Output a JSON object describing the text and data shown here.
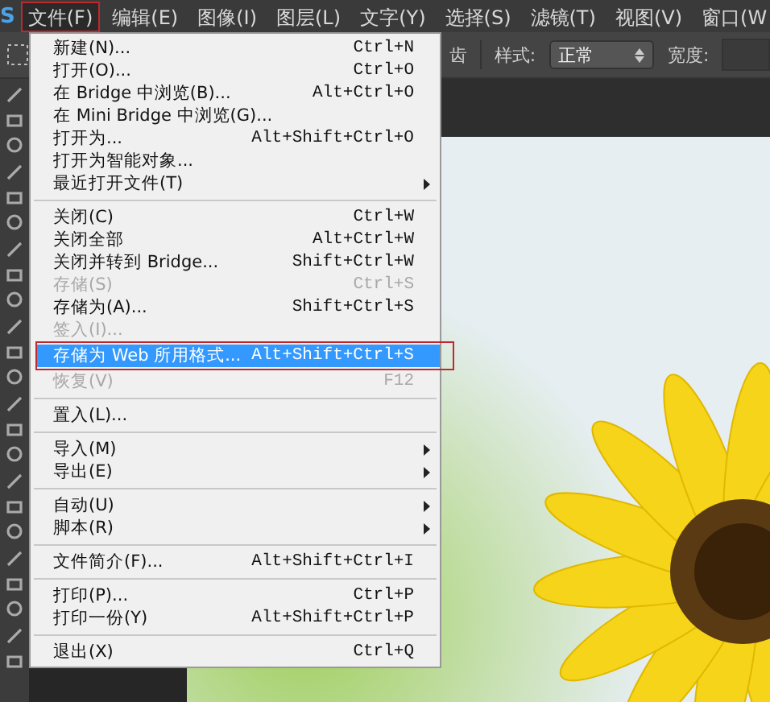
{
  "app_logo": "S",
  "menubar": [
    {
      "label": "文件(F)",
      "selected": true,
      "outlined": true
    },
    {
      "label": "编辑(E)",
      "selected": false,
      "outlined": false
    },
    {
      "label": "图像(I)",
      "selected": false,
      "outlined": false
    },
    {
      "label": "图层(L)",
      "selected": false,
      "outlined": false
    },
    {
      "label": "文字(Y)",
      "selected": false,
      "outlined": false
    },
    {
      "label": "选择(S)",
      "selected": false,
      "outlined": false
    },
    {
      "label": "滤镜(T)",
      "selected": false,
      "outlined": false
    },
    {
      "label": "视图(V)",
      "selected": false,
      "outlined": false
    },
    {
      "label": "窗口(W",
      "selected": false,
      "outlined": false
    }
  ],
  "options_bar": {
    "antialias_label": "齿",
    "style_label": "样式:",
    "style_value": "正常",
    "width_label": "宽度:"
  },
  "file_menu": [
    {
      "kind": "item",
      "label": "新建(N)...",
      "shortcut": "Ctrl+N",
      "disabled": false,
      "selected": false,
      "submenu": false,
      "outlined": false
    },
    {
      "kind": "item",
      "label": "打开(O)...",
      "shortcut": "Ctrl+O",
      "disabled": false,
      "selected": false,
      "submenu": false,
      "outlined": false
    },
    {
      "kind": "item",
      "label": "在 Bridge 中浏览(B)...",
      "shortcut": "Alt+Ctrl+O",
      "disabled": false,
      "selected": false,
      "submenu": false,
      "outlined": false
    },
    {
      "kind": "item",
      "label": "在 Mini Bridge 中浏览(G)...",
      "disabled": false,
      "selected": false,
      "submenu": false,
      "outlined": false
    },
    {
      "kind": "item",
      "label": "打开为...",
      "shortcut": "Alt+Shift+Ctrl+O",
      "disabled": false,
      "selected": false,
      "submenu": false,
      "outlined": false
    },
    {
      "kind": "item",
      "label": "打开为智能对象...",
      "disabled": false,
      "selected": false,
      "submenu": false,
      "outlined": false
    },
    {
      "kind": "item",
      "label": "最近打开文件(T)",
      "disabled": false,
      "selected": false,
      "submenu": true,
      "outlined": false
    },
    {
      "kind": "separator"
    },
    {
      "kind": "item",
      "label": "关闭(C)",
      "shortcut": "Ctrl+W",
      "disabled": false,
      "selected": false,
      "submenu": false,
      "outlined": false
    },
    {
      "kind": "item",
      "label": "关闭全部",
      "shortcut": "Alt+Ctrl+W",
      "disabled": false,
      "selected": false,
      "submenu": false,
      "outlined": false
    },
    {
      "kind": "item",
      "label": "关闭并转到 Bridge...",
      "shortcut": "Shift+Ctrl+W",
      "disabled": false,
      "selected": false,
      "submenu": false,
      "outlined": false
    },
    {
      "kind": "item",
      "label": "存储(S)",
      "shortcut": "Ctrl+S",
      "disabled": true,
      "selected": false,
      "submenu": false,
      "outlined": false
    },
    {
      "kind": "item",
      "label": "存储为(A)...",
      "shortcut": "Shift+Ctrl+S",
      "disabled": false,
      "selected": false,
      "submenu": false,
      "outlined": false
    },
    {
      "kind": "item",
      "label": "签入(I)...",
      "disabled": true,
      "selected": false,
      "submenu": false,
      "outlined": false
    },
    {
      "kind": "item",
      "label": "存储为 Web 所用格式...",
      "shortcut": "Alt+Shift+Ctrl+S",
      "disabled": false,
      "selected": true,
      "submenu": false,
      "outlined": true
    },
    {
      "kind": "item",
      "label": "恢复(V)",
      "shortcut": "F12",
      "disabled": true,
      "selected": false,
      "submenu": false,
      "outlined": false
    },
    {
      "kind": "separator"
    },
    {
      "kind": "item",
      "label": "置入(L)...",
      "disabled": false,
      "selected": false,
      "submenu": false,
      "outlined": false
    },
    {
      "kind": "separator"
    },
    {
      "kind": "item",
      "label": "导入(M)",
      "disabled": false,
      "selected": false,
      "submenu": true,
      "outlined": false
    },
    {
      "kind": "item",
      "label": "导出(E)",
      "disabled": false,
      "selected": false,
      "submenu": true,
      "outlined": false
    },
    {
      "kind": "separator"
    },
    {
      "kind": "item",
      "label": "自动(U)",
      "disabled": false,
      "selected": false,
      "submenu": true,
      "outlined": false
    },
    {
      "kind": "item",
      "label": "脚本(R)",
      "disabled": false,
      "selected": false,
      "submenu": true,
      "outlined": false
    },
    {
      "kind": "separator"
    },
    {
      "kind": "item",
      "label": "文件简介(F)...",
      "shortcut": "Alt+Shift+Ctrl+I",
      "disabled": false,
      "selected": false,
      "submenu": false,
      "outlined": false
    },
    {
      "kind": "separator"
    },
    {
      "kind": "item",
      "label": "打印(P)...",
      "shortcut": "Ctrl+P",
      "disabled": false,
      "selected": false,
      "submenu": false,
      "outlined": false
    },
    {
      "kind": "item",
      "label": "打印一份(Y)",
      "shortcut": "Alt+Shift+Ctrl+P",
      "disabled": false,
      "selected": false,
      "submenu": false,
      "outlined": false
    },
    {
      "kind": "separator"
    },
    {
      "kind": "item",
      "label": "退出(X)",
      "shortcut": "Ctrl+Q",
      "disabled": false,
      "selected": false,
      "submenu": false,
      "outlined": false
    }
  ]
}
